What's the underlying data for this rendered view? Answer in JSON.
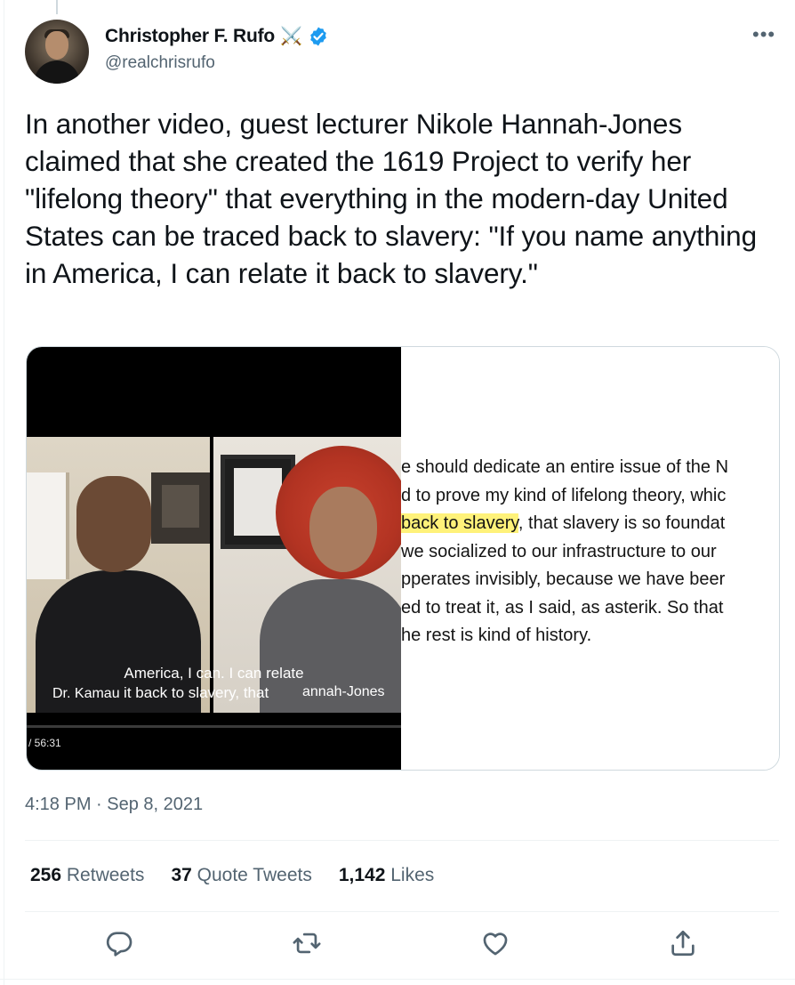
{
  "author": {
    "name": "Christopher F. Rufo",
    "badge_emoji": "⚔️",
    "handle": "@realchrisrufo"
  },
  "more_icon": "more-horizontal-icon",
  "tweet": {
    "text": "In another video, guest lecturer Nikole Hannah-Jones claimed that she created the 1619 Project to verify her \"lifelong theory\" that everything in the modern-day United States can be traced back to slavery: \"If you name anything in America, I can relate it back to slavery.\""
  },
  "media": {
    "video": {
      "caption_line1": "America, I can. I can relate",
      "caption_line2": "it back to slavery, that",
      "name_tag_left": "Dr. Kamau",
      "name_tag_right": "annah-Jones",
      "time": "/ 56:31"
    },
    "transcript": [
      {
        "pre": "e should dedicate an entire issue of the N",
        "hl": "",
        "post": ""
      },
      {
        "pre": "d to prove my kind of lifelong theory, whic",
        "hl": "",
        "post": ""
      },
      {
        "pre": "",
        "hl": "back to slavery",
        "post": ", that slavery is so foundat"
      },
      {
        "pre": "we socialized to our infrastructure to our",
        "hl": "",
        "post": ""
      },
      {
        "pre": "pperates invisibly, because we have beer",
        "hl": "",
        "post": ""
      },
      {
        "pre": "ed to treat it, as I said, as asterik. So that",
        "hl": "",
        "post": ""
      },
      {
        "pre": "he rest is kind of history.",
        "hl": "",
        "post": ""
      }
    ],
    "highlight_color": "#fff27a"
  },
  "timestamp": "4:18 PM · Sep 8, 2021",
  "stats": {
    "retweets": {
      "count": "256",
      "label": "Retweets"
    },
    "quotes": {
      "count": "37",
      "label": "Quote Tweets"
    },
    "likes": {
      "count": "1,142",
      "label": "Likes"
    }
  },
  "actions": [
    "reply-icon",
    "retweet-icon",
    "like-icon",
    "share-icon"
  ],
  "colors": {
    "verified": "#1d9bf0",
    "secondary_text": "#536471",
    "primary_text": "#0f1419"
  }
}
